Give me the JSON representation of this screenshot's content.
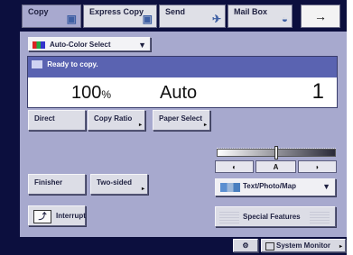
{
  "tabs": [
    {
      "label": "Copy",
      "icon": "copy-icon"
    },
    {
      "label": "Express Copy",
      "icon": "express-copy-icon"
    },
    {
      "label": "Send",
      "icon": "send-icon"
    },
    {
      "label": "Mail Box",
      "icon": "mailbox-icon"
    }
  ],
  "tab_arrow_glyph": "→",
  "color_select": {
    "label": "Auto-Color Select",
    "icon": "color-icon",
    "dropdown_glyph": "▼"
  },
  "status": {
    "message": "Ready to copy.",
    "ratio_value": "100",
    "ratio_unit": "%",
    "paper": "Auto",
    "copies": "1"
  },
  "buttons": {
    "direct": "Direct",
    "copy_ratio": "Copy Ratio",
    "paper_select": "Paper Select",
    "finisher": "Finisher",
    "two_sided": "Two-sided",
    "interrupt": "Interrupt",
    "special_features": "Special Features"
  },
  "density": {
    "light_glyph": "◐",
    "auto_label": "A",
    "dark_glyph": "◗",
    "level": 0.5
  },
  "original_type": {
    "label": "Text/Photo/Map",
    "dropdown_glyph": "▼"
  },
  "system_monitor": {
    "label": "System Monitor",
    "arrow_glyph": "▸"
  },
  "colors": {
    "frame": "#0c0f3e",
    "panel": "#a7a9ce",
    "status_bar": "#5a63b1",
    "button": "#dcdde6"
  }
}
